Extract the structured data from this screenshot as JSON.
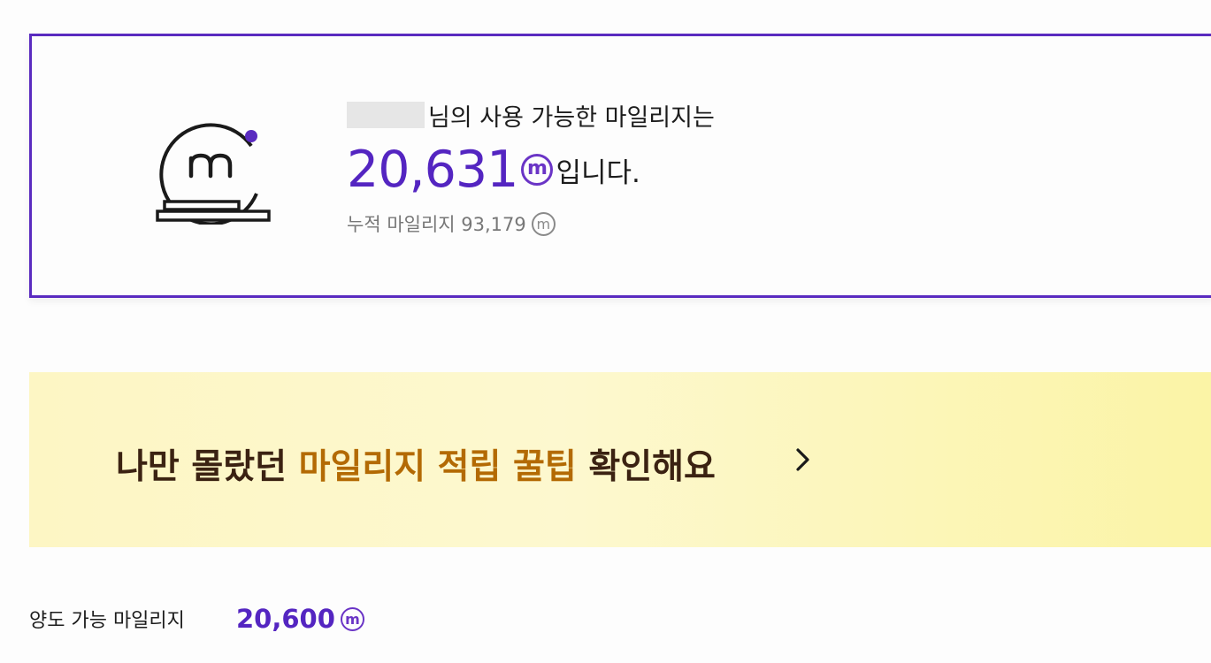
{
  "summary": {
    "greeting_suffix": "님의 사용 가능한 마일리지는",
    "available_amount": "20,631",
    "available_suffix": "입니다.",
    "cumulative_label": "누적 마일리지 93,179",
    "mileage_unit_glyph": "m"
  },
  "tip_banner": {
    "prefix": "나만 몰랐던",
    "highlight": "마일리지 적립 꿀팁",
    "suffix": "확인해요"
  },
  "transfer": {
    "label": "양도 가능 마일리지",
    "amount": "20,600"
  },
  "colors": {
    "accent": "#5425c1",
    "card_border": "#5a2bc0",
    "tip_highlight": "#b36a04",
    "tip_text": "#3b2212"
  },
  "icons": [
    "mileage-coin-icon",
    "mileage-unit-icon",
    "chevron-right-icon"
  ]
}
